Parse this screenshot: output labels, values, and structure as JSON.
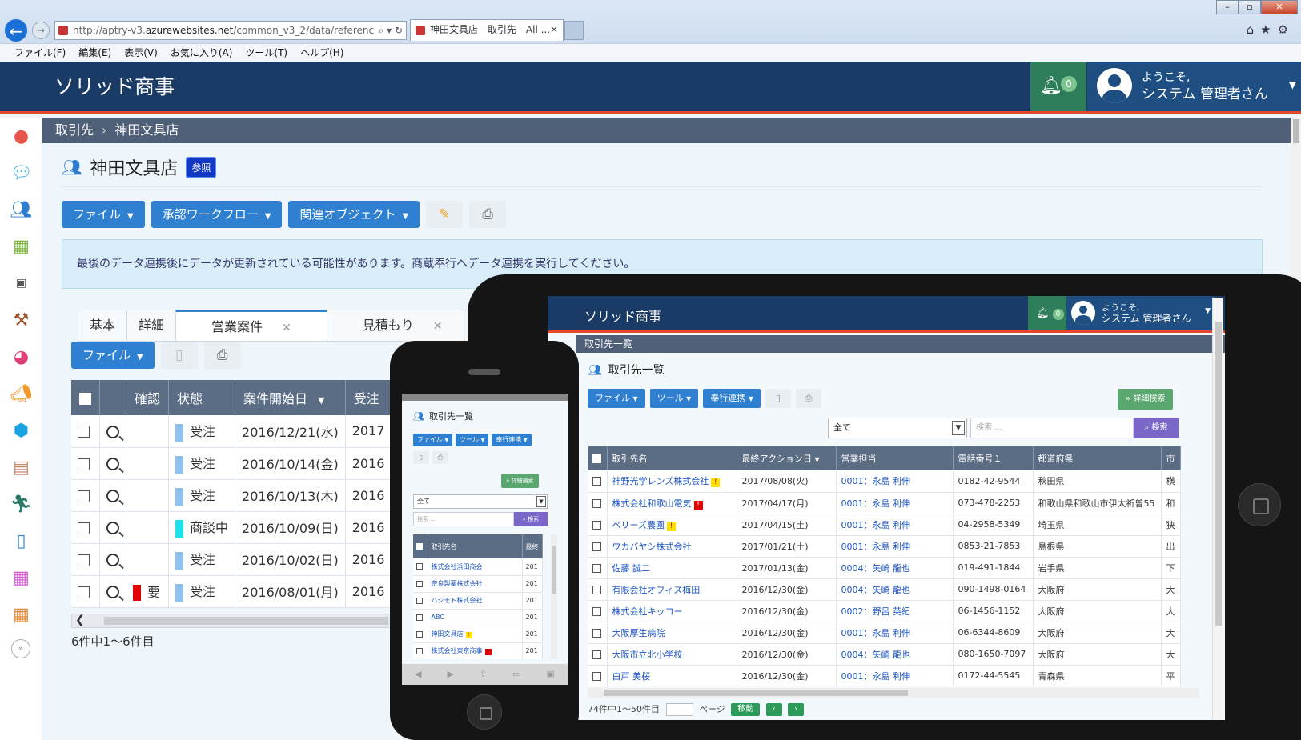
{
  "browser": {
    "url_prefix": "http://aptry-v3.",
    "url_domain": "azurewebsites.net",
    "url_suffix": "/common_v3_2/data/referenc",
    "tab_title": "神田文具店 - 取引先 - All ...",
    "menu": [
      "ファイル(F)",
      "編集(E)",
      "表示(V)",
      "お気に入り(A)",
      "ツール(T)",
      "ヘルプ(H)"
    ]
  },
  "app": {
    "brand": "ソリッド商事",
    "notification_count": "0",
    "welcome_line1": "ようこそ,",
    "welcome_line2": "システム 管理者さん"
  },
  "breadcrumb": {
    "root": "取引先",
    "current": "神田文具店"
  },
  "page": {
    "title": "神田文具店",
    "badge": "参照",
    "toolbar": {
      "file": "ファイル",
      "workflow": "承認ワークフロー",
      "related": "関連オブジェクト"
    },
    "alert": "最後のデータ連携後にデータが更新されている可能性があります。商蔵奉行へデータ連携を実行してください。",
    "tabs": {
      "basic": "基本",
      "detail": "詳細",
      "sales": "営業案件",
      "quote": "見積もり"
    },
    "sub_file": "ファイル",
    "grid": {
      "headers": {
        "confirm": "確認",
        "status": "状態",
        "start_date": "案件開始日",
        "order": "受注"
      },
      "rows": [
        {
          "flag": "",
          "status": "受注",
          "date": "2016/12/21(水)",
          "order": "2017"
        },
        {
          "flag": "",
          "status": "受注",
          "date": "2016/10/14(金)",
          "order": "2016"
        },
        {
          "flag": "",
          "status": "受注",
          "date": "2016/10/13(木)",
          "order": "2016"
        },
        {
          "flag": "",
          "status": "商談中",
          "date": "2016/10/09(日)",
          "order": "2016"
        },
        {
          "flag": "",
          "status": "受注",
          "date": "2016/10/02(日)",
          "order": "2016"
        },
        {
          "flag": "要",
          "status": "受注",
          "date": "2016/08/01(月)",
          "order": "2016"
        }
      ]
    },
    "count": "6件中1～6件目"
  },
  "tablet": {
    "brand": "ソリッド商事",
    "notification_count": "0",
    "welcome_line1": "ようこそ,",
    "welcome_line2": "システム 管理者さん",
    "crumb": "取引先一覧",
    "title": "取引先一覧",
    "toolbar": {
      "file": "ファイル",
      "tool": "ツール",
      "bugyo": "奉行連携"
    },
    "advanced": "詳細検索",
    "filter_value": "全て",
    "search_placeholder": "検索 ...",
    "search_button": "検索",
    "headers": {
      "name": "取引先名",
      "last_action": "最終アクション日",
      "sales_rep": "営業担当",
      "phone": "電話番号１",
      "pref": "都道府県",
      "more": "市"
    },
    "rows": [
      {
        "name": "神野光学レンズ株式会社",
        "warn": "yellow",
        "date": "2017/08/08(火)",
        "rep": "0001：永島 利伸",
        "phone": "0182-42-9544",
        "pref": "秋田県",
        "more": "横"
      },
      {
        "name": "株式会社和歌山電気",
        "warn": "red",
        "date": "2017/04/17(月)",
        "rep": "0001：永島 利伸",
        "phone": "073-478-2253",
        "pref": "和歌山県和歌山市伊太祈曽55",
        "more": "和"
      },
      {
        "name": "ベリーズ農園",
        "warn": "yellow",
        "date": "2017/04/15(土)",
        "rep": "0001：永島 利伸",
        "phone": "04-2958-5349",
        "pref": "埼玉県",
        "more": "狭"
      },
      {
        "name": "ワカバヤシ株式会社",
        "warn": "",
        "date": "2017/01/21(土)",
        "rep": "0001：永島 利伸",
        "phone": "0853-21-7853",
        "pref": "島根県",
        "more": "出"
      },
      {
        "name": "佐藤 誠二",
        "warn": "",
        "date": "2017/01/13(金)",
        "rep": "0004：矢崎 龍也",
        "phone": "019-491-1844",
        "pref": "岩手県",
        "more": "下"
      },
      {
        "name": "有限会社オフィス梅田",
        "warn": "",
        "date": "2016/12/30(金)",
        "rep": "0004：矢崎 龍也",
        "phone": "090-1498-0164",
        "pref": "大阪府",
        "more": "大"
      },
      {
        "name": "株式会社キッコー",
        "warn": "",
        "date": "2016/12/30(金)",
        "rep": "0002：野呂 英紀",
        "phone": "06-1456-1152",
        "pref": "大阪府",
        "more": "大"
      },
      {
        "name": "大阪厚生病院",
        "warn": "",
        "date": "2016/12/30(金)",
        "rep": "0001：永島 利伸",
        "phone": "06-6344-8609",
        "pref": "大阪府",
        "more": "大"
      },
      {
        "name": "大阪市立北小学校",
        "warn": "",
        "date": "2016/12/30(金)",
        "rep": "0004：矢崎 龍也",
        "phone": "080-1650-7097",
        "pref": "大阪府",
        "more": "大"
      },
      {
        "name": "白戸 美桜",
        "warn": "",
        "date": "2016/12/30(金)",
        "rep": "0001：永島 利伸",
        "phone": "0172-44-5545",
        "pref": "青森県",
        "more": "平"
      }
    ],
    "pager_text": "74件中1～50件目",
    "pager_page": "ページ",
    "pager_move": "移動"
  },
  "phone": {
    "title": "取引先一覧",
    "toolbar": {
      "file": "ファイル",
      "tool": "ツール",
      "bugyo": "奉行連携"
    },
    "advanced": "詳細検索",
    "filter_value": "全て",
    "search_placeholder": "検索 ...",
    "search_button": "検索",
    "headers": {
      "name": "取引先名",
      "more": "最終"
    },
    "rows": [
      {
        "name": "株式会社浜田商会",
        "warn": "",
        "more": "201"
      },
      {
        "name": "奈良製薬株式会社",
        "warn": "",
        "more": "201"
      },
      {
        "name": "ハシモト株式会社",
        "warn": "",
        "more": "201"
      },
      {
        "name": "ABC",
        "warn": "",
        "more": "201"
      },
      {
        "name": "神田文具店",
        "warn": "yellow",
        "more": "201"
      },
      {
        "name": "株式会社東京商事",
        "warn": "red",
        "more": "201"
      }
    ]
  },
  "icons": {
    "bell": "bell-icon",
    "people": "people-icon",
    "pencil": "pencil-icon",
    "print": "print-icon",
    "doc": "document-icon",
    "search": "search-icon"
  },
  "colors": {
    "header": "#1a3b66",
    "accent_red": "#e4472c",
    "primary": "#2f80d0",
    "grid_header": "#5b6c85",
    "notification": "#2e7d5b"
  }
}
